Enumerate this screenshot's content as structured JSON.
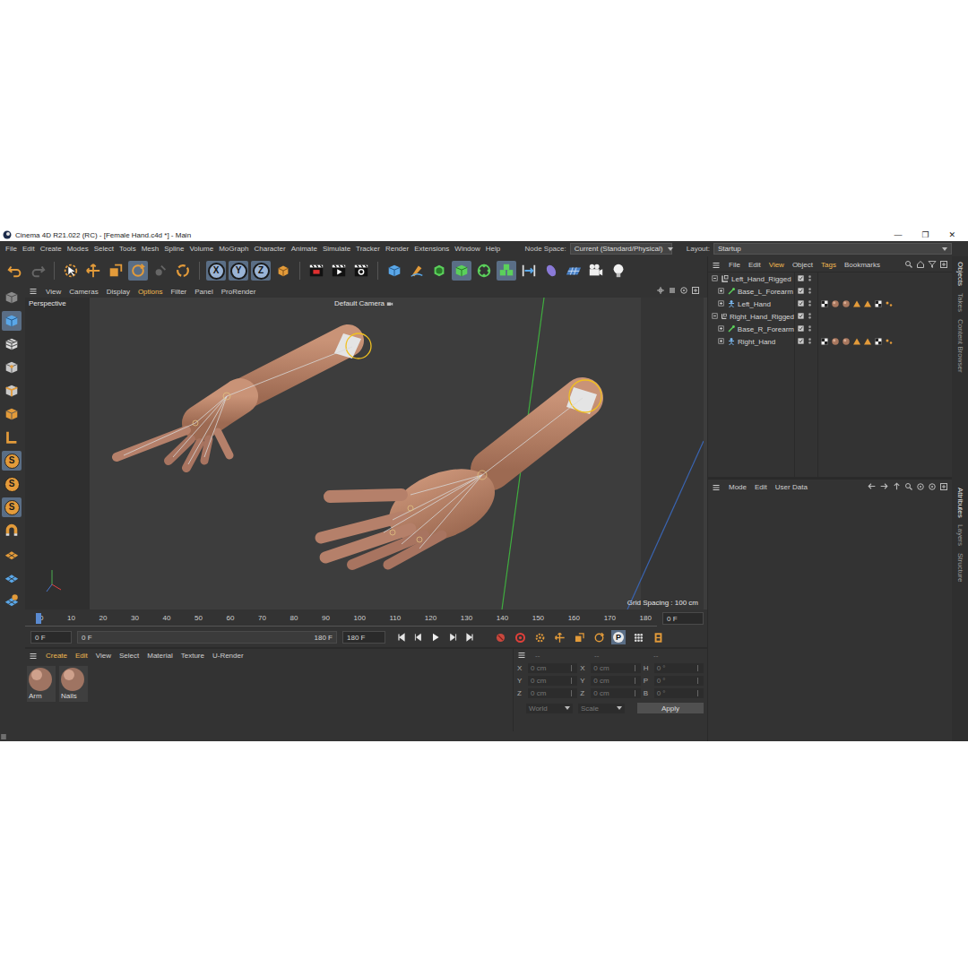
{
  "window": {
    "title": "Cinema 4D R21.022 (RC) - [Female Hand.c4d *] - Main",
    "controls": [
      "—",
      "❐",
      "✕"
    ]
  },
  "menu": [
    "File",
    "Edit",
    "Create",
    "Modes",
    "Select",
    "Tools",
    "Mesh",
    "Spline",
    "Volume",
    "MoGraph",
    "Character",
    "Animate",
    "Simulate",
    "Tracker",
    "Render",
    "Extensions",
    "Window",
    "Help"
  ],
  "node_space": {
    "label": "Node Space:",
    "value": "Current (Standard/Physical)"
  },
  "layout": {
    "label": "Layout:",
    "value": "Startup"
  },
  "toolbar": [
    {
      "kind": "undo",
      "selected": false
    },
    {
      "kind": "redo",
      "selected": false
    },
    {
      "kind": "separator",
      "selected": false
    },
    {
      "kind": "select",
      "selected": false
    },
    {
      "kind": "move",
      "selected": false
    },
    {
      "kind": "scale",
      "selected": false
    },
    {
      "kind": "rotate",
      "selected": true
    },
    {
      "kind": "disabled-tool",
      "selected": false
    },
    {
      "kind": "recent",
      "selected": false
    },
    {
      "kind": "separator",
      "selected": false
    },
    {
      "kind": "axis",
      "label": "X",
      "selected": true
    },
    {
      "kind": "axis",
      "label": "Y",
      "selected": true
    },
    {
      "kind": "axis",
      "label": "Z",
      "selected": true
    },
    {
      "kind": "coord",
      "selected": false
    },
    {
      "kind": "separator",
      "selected": false
    },
    {
      "kind": "render-view",
      "selected": false
    },
    {
      "kind": "render",
      "selected": false
    },
    {
      "kind": "render-settings",
      "selected": false
    },
    {
      "kind": "separator",
      "selected": false
    },
    {
      "kind": "cube",
      "selected": false
    },
    {
      "kind": "pen",
      "selected": false
    },
    {
      "kind": "subdivision",
      "selected": false
    },
    {
      "kind": "extrude",
      "selected": true
    },
    {
      "kind": "cloner",
      "selected": false
    },
    {
      "kind": "array",
      "selected": true
    },
    {
      "kind": "deformer",
      "selected": false
    },
    {
      "kind": "field",
      "selected": false
    },
    {
      "kind": "floor",
      "selected": false
    },
    {
      "kind": "camera",
      "selected": false
    },
    {
      "kind": "light",
      "selected": false
    }
  ],
  "left_tools": [
    {
      "kind": "make-editable",
      "selected": false
    },
    {
      "kind": "model",
      "selected": true
    },
    {
      "kind": "texture",
      "selected": false
    },
    {
      "kind": "points",
      "selected": false
    },
    {
      "kind": "edges",
      "selected": false
    },
    {
      "kind": "polygons",
      "selected": false
    },
    {
      "kind": "workplane",
      "selected": false
    },
    {
      "kind": "snap",
      "label": "S",
      "selected": true
    },
    {
      "kind": "snap",
      "label": "S",
      "selected": false
    },
    {
      "kind": "snap",
      "label": "S",
      "selected": true
    },
    {
      "kind": "magnet",
      "selected": false
    },
    {
      "kind": "grid-snap",
      "selected": false
    },
    {
      "kind": "grid-snap-2",
      "selected": false
    },
    {
      "kind": "lock",
      "selected": false
    }
  ],
  "viewport": {
    "menu": [
      {
        "label": "View",
        "highlighted": false
      },
      {
        "label": "Cameras",
        "highlighted": false
      },
      {
        "label": "Display",
        "highlighted": false
      },
      {
        "label": "Options",
        "highlighted": true
      },
      {
        "label": "Filter",
        "highlighted": false
      },
      {
        "label": "Panel",
        "highlighted": false
      },
      {
        "label": "ProRender",
        "highlighted": false
      }
    ],
    "title": "Perspective",
    "camera": "Default Camera",
    "grid": "Grid Spacing : 100 cm"
  },
  "timeline": {
    "ticks": [
      "0",
      "10",
      "20",
      "30",
      "40",
      "50",
      "60",
      "70",
      "80",
      "90",
      "100",
      "110",
      "120",
      "130",
      "140",
      "150",
      "160",
      "170",
      "180"
    ],
    "frame": "0 F",
    "level": 0
  },
  "transport": {
    "start": "0 F",
    "preview_start": "0 F",
    "preview_end": "180 F",
    "end": "180 F",
    "level": 1,
    "buttons": [
      {
        "kind": "first"
      },
      {
        "kind": "prev"
      },
      {
        "kind": "play"
      },
      {
        "kind": "next"
      },
      {
        "kind": "last"
      }
    ],
    "keys": [
      {
        "kind": "record"
      },
      {
        "kind": "autokey"
      },
      {
        "kind": "keyframe"
      },
      {
        "kind": "move"
      },
      {
        "kind": "scale"
      },
      {
        "kind": "rotate"
      },
      {
        "kind": "param",
        "label": "P"
      },
      {
        "kind": "pla"
      },
      {
        "kind": "film"
      }
    ]
  },
  "materials": {
    "menu": [
      {
        "label": "Create",
        "highlighted": true
      },
      {
        "label": "Edit",
        "highlighted": true
      },
      {
        "label": "View",
        "highlighted": false
      },
      {
        "label": "Select",
        "highlighted": false
      },
      {
        "label": "Material",
        "highlighted": false
      },
      {
        "label": "Texture",
        "highlighted": false
      },
      {
        "label": "U-Render",
        "highlighted": false
      }
    ],
    "items": [
      {
        "name": "Arm"
      },
      {
        "name": "Nails"
      }
    ]
  },
  "coordinates": {
    "headers": [
      "--",
      "--",
      "--"
    ],
    "disabled": true,
    "rows": [
      {
        "cells": [
          {
            "axis": "X",
            "value": "0 cm"
          },
          {
            "axis": "X",
            "value": "0 cm"
          },
          {
            "axis": "H",
            "value": "0 °"
          }
        ]
      },
      {
        "cells": [
          {
            "axis": "Y",
            "value": "0 cm"
          },
          {
            "axis": "Y",
            "value": "0 cm"
          },
          {
            "axis": "P",
            "value": "0 °"
          }
        ]
      },
      {
        "cells": [
          {
            "axis": "Z",
            "value": "0 cm"
          },
          {
            "axis": "Z",
            "value": "0 cm"
          },
          {
            "axis": "B",
            "value": "0 °"
          }
        ]
      }
    ],
    "dropdowns": [
      "World",
      "Scale"
    ],
    "apply": "Apply"
  },
  "objects": {
    "menu": [
      {
        "label": "File",
        "highlighted": false
      },
      {
        "label": "Edit",
        "highlighted": false
      },
      {
        "label": "View",
        "highlighted": true
      },
      {
        "label": "Object",
        "highlighted": false
      },
      {
        "label": "Tags",
        "highlighted": true
      },
      {
        "label": "Bookmarks",
        "highlighted": false
      }
    ],
    "items": [
      {
        "name": "Left_Hand_Rigged",
        "kind": "null",
        "expanded": true
      },
      {
        "name": "Base_L_Forearm",
        "kind": "joint",
        "expanded": false
      },
      {
        "name": "Left_Hand",
        "kind": "mesh",
        "expanded": false
      },
      {
        "name": "Right_Hand_Rigged",
        "kind": "null",
        "expanded": true
      },
      {
        "name": "Base_R_Forearm",
        "kind": "joint",
        "expanded": false
      },
      {
        "name": "Right_Hand",
        "kind": "mesh",
        "expanded": false
      }
    ]
  },
  "attributes": {
    "menu": [
      "Mode",
      "Edit",
      "User Data"
    ]
  },
  "side_tabs": {
    "top": [
      {
        "label": "Objects",
        "selected": true
      },
      {
        "label": "Takes",
        "selected": false
      },
      {
        "label": "Content Browser",
        "selected": false
      }
    ],
    "bottom": [
      {
        "label": "Attributes",
        "selected": true
      },
      {
        "label": "Layers",
        "selected": false
      },
      {
        "label": "Structure",
        "selected": false
      }
    ]
  }
}
